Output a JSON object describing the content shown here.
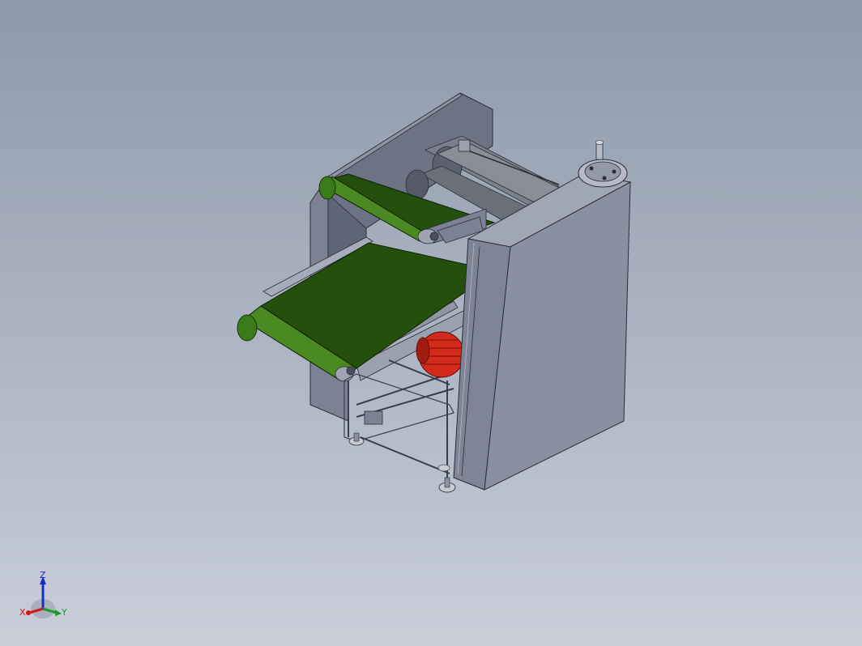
{
  "viewport": {
    "background_top": "#8c9aab",
    "background_bottom": "#c9ced9"
  },
  "model": {
    "belt_color": "#244f0c",
    "belt_edge_color": "#4b8a22",
    "housing_color": "#8a90a1",
    "motor_color": "#d42a1c"
  },
  "triad": {
    "z_label": "Z",
    "x_label": "X",
    "y_label": "Y",
    "x_color": "#d01818",
    "y_color": "#1a9a2a",
    "z_color": "#1a2ad0"
  }
}
